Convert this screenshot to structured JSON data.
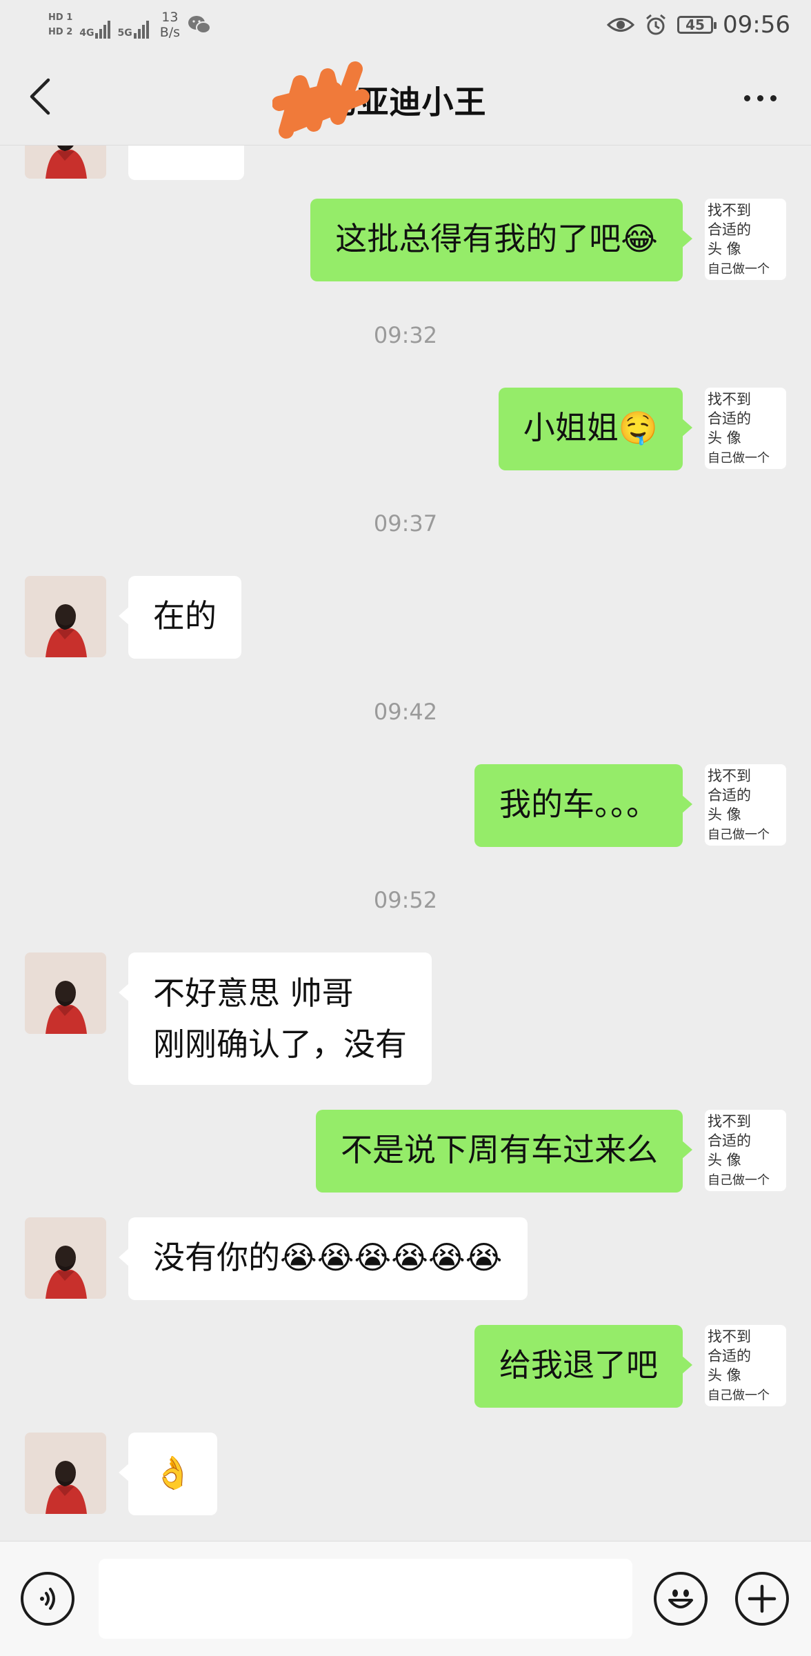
{
  "status_bar": {
    "sim1": "HD 1",
    "sim2": "HD 2",
    "net1": "4G",
    "net2": "5G",
    "speed_value": "13",
    "speed_unit": "B/s",
    "battery": "45",
    "time": "09:56",
    "icons": [
      "wechat-icon",
      "eye-icon",
      "alarm-icon",
      "battery-icon"
    ]
  },
  "header": {
    "title": "比亚迪小王",
    "back_icon": "chevron-left-icon",
    "more_icon": "more-dots-icon",
    "redaction_color": "#f07a3a"
  },
  "messages": {
    "m1": {
      "text": "这批总得有我的了吧😂"
    },
    "t1": "09:32",
    "m2": {
      "text": "小姐姐🤤"
    },
    "t2": "09:37",
    "m3": {
      "text": "在的"
    },
    "t3": "09:42",
    "m4": {
      "text": "我的车。。。"
    },
    "t4": "09:52",
    "m5": {
      "line1": "不好意思 帅哥",
      "line2": "刚刚确认了，没有"
    },
    "m6": {
      "text": "不是说下周有车过来么"
    },
    "m7": {
      "text": "没有你的😭😭😭😭😭😭"
    },
    "m8": {
      "text": "给我退了吧"
    },
    "m9": {
      "text": "👌"
    }
  },
  "my_avatar_text": [
    "找不到",
    "合适的",
    "头像",
    "自己做一个"
  ],
  "input_bar": {
    "voice_icon": "voice-icon",
    "emoji_icon": "emoji-icon",
    "plus_icon": "plus-icon",
    "input_value": ""
  },
  "colors": {
    "background": "#ededed",
    "my_bubble": "#95ec69",
    "her_bubble": "#ffffff",
    "timestamp": "#9a9a9a"
  }
}
